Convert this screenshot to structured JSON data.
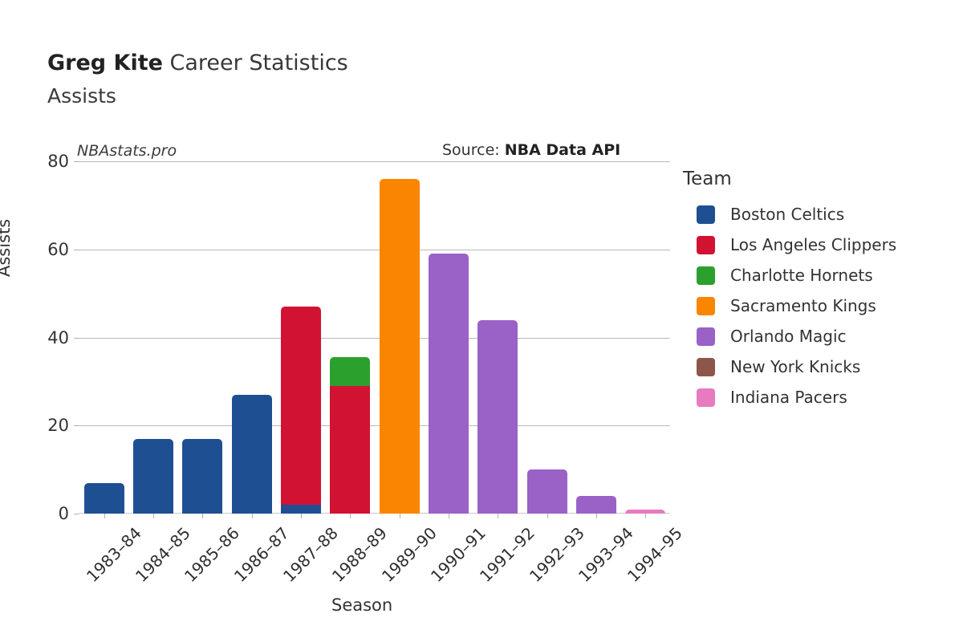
{
  "header": {
    "player_name": "Greg Kite",
    "title_rest": " Career Statistics",
    "subtitle": "Assists",
    "watermark": "NBAstats.pro",
    "source_prefix": "Source: ",
    "source_value": "NBA Data API"
  },
  "legend": {
    "title": "Team",
    "items": [
      {
        "label": "Boston Celtics",
        "color": "#1f4f93"
      },
      {
        "label": "Los Angeles Clippers",
        "color": "#d21233"
      },
      {
        "label": "Charlotte Hornets",
        "color": "#2ca02c"
      },
      {
        "label": "Sacramento Kings",
        "color": "#fa8500"
      },
      {
        "label": "Orlando Magic",
        "color": "#9a62c6"
      },
      {
        "label": "New York Knicks",
        "color": "#8c564b"
      },
      {
        "label": "Indiana Pacers",
        "color": "#e87ac0"
      }
    ]
  },
  "chart_data": {
    "type": "bar",
    "stacked": true,
    "title": "Greg Kite Career Statistics",
    "subtitle": "Assists",
    "xlabel": "Season",
    "ylabel": "Assists",
    "ylim": [
      0,
      80
    ],
    "yticks": [
      0,
      20,
      40,
      60,
      80
    ],
    "grid": "horizontal",
    "legend_position": "right",
    "legend_title": "Team",
    "categories": [
      "1983–84",
      "1984–85",
      "1985–86",
      "1986–87",
      "1987–88",
      "1988–89",
      "1989–90",
      "1990–91",
      "1991–92",
      "1992–93",
      "1993–94",
      "1994–95"
    ],
    "series": [
      {
        "name": "Boston Celtics",
        "color": "#1f4f93",
        "values": [
          7,
          17,
          17,
          27,
          2,
          0,
          0,
          0,
          0,
          0,
          0,
          0
        ]
      },
      {
        "name": "Los Angeles Clippers",
        "color": "#d21233",
        "values": [
          0,
          0,
          0,
          0,
          45,
          29,
          0,
          0,
          0,
          0,
          0,
          0
        ]
      },
      {
        "name": "Charlotte Hornets",
        "color": "#2ca02c",
        "values": [
          0,
          0,
          0,
          0,
          0,
          6.5,
          0,
          0,
          0,
          0,
          0,
          0
        ]
      },
      {
        "name": "Sacramento Kings",
        "color": "#fa8500",
        "values": [
          0,
          0,
          0,
          0,
          0,
          0,
          76,
          0,
          0,
          0,
          0,
          0
        ]
      },
      {
        "name": "Orlando Magic",
        "color": "#9a62c6",
        "values": [
          0,
          0,
          0,
          0,
          0,
          0,
          0,
          59,
          44,
          10,
          4,
          0
        ]
      },
      {
        "name": "New York Knicks",
        "color": "#8c564b",
        "values": [
          0,
          0,
          0,
          0,
          0,
          0,
          0,
          0,
          0,
          0,
          0,
          0
        ]
      },
      {
        "name": "Indiana Pacers",
        "color": "#e87ac0",
        "values": [
          0,
          0,
          0,
          0,
          0,
          0,
          0,
          0,
          0,
          0,
          0,
          1
        ]
      }
    ],
    "totals": [
      7,
      17,
      17,
      27,
      47,
      35.5,
      76,
      59,
      44,
      10,
      4,
      1
    ]
  }
}
